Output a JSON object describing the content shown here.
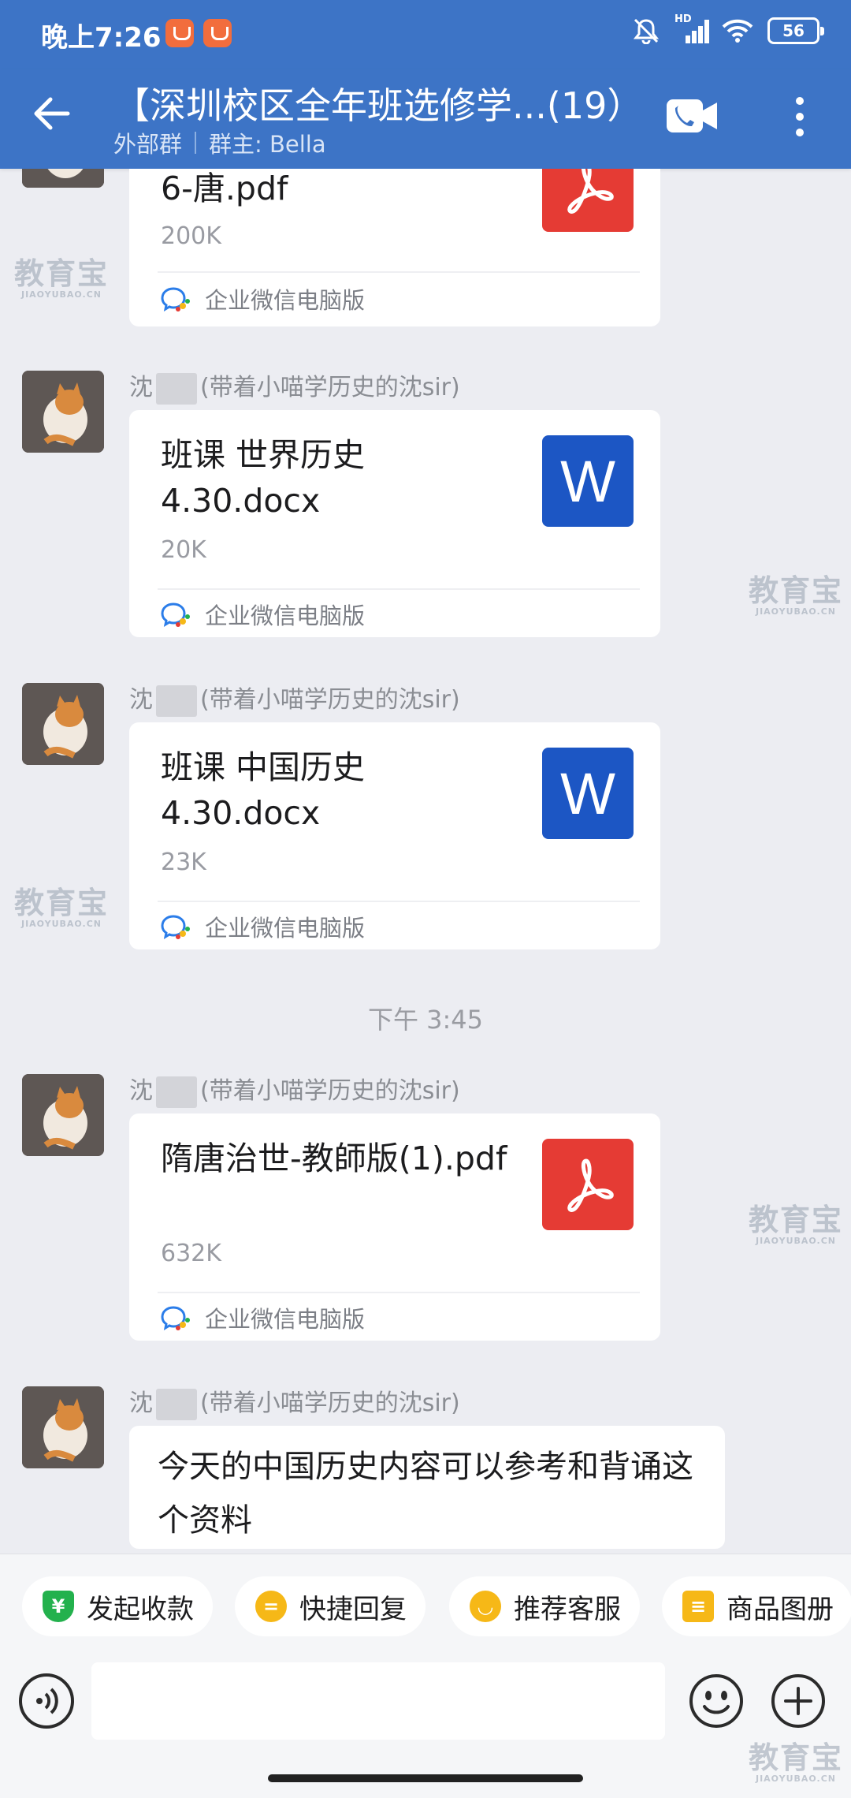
{
  "status_bar": {
    "time": "晚上7:26",
    "signal_label": "HD",
    "battery": "56"
  },
  "header": {
    "title": "【深圳校区全年班选修学...(19）",
    "group_type": "外部群",
    "owner": "群主: Bella"
  },
  "messages": {
    "m0": {
      "file_name": "6-唐.pdf",
      "file_size": "200K",
      "source": "企业微信电脑版"
    },
    "m1": {
      "sender_prefix": "沈",
      "sender_suffix": "(带着小喵学历史的沈sir)",
      "file_name": "班课 世界历史 4.30.docx",
      "file_size": "20K",
      "source": "企业微信电脑版"
    },
    "m2": {
      "sender_prefix": "沈",
      "sender_suffix": "(带着小喵学历史的沈sir)",
      "file_name": "班课 中国历史 4.30.docx",
      "file_size": "23K",
      "source": "企业微信电脑版"
    },
    "timestamp": "下午 3:45",
    "m3": {
      "sender_prefix": "沈",
      "sender_suffix": "(带着小喵学历史的沈sir)",
      "file_name": "隋唐治世-教師版(1).pdf",
      "file_size": "632K",
      "source": "企业微信电脑版"
    },
    "m4": {
      "sender_prefix": "沈",
      "sender_suffix": "(带着小喵学历史的沈sir)",
      "text": "今天的中国历史内容可以参考和背诵这个资料"
    }
  },
  "word_icon_letter": "W",
  "watermark": {
    "main": "教育宝",
    "sub": "JIAOYUBAO.CN"
  },
  "quick_actions": [
    "发起收款",
    "快捷回复",
    "推荐客服",
    "商品图册"
  ],
  "colors": {
    "header": "#3d74c6",
    "pdf": "#e53b34",
    "word": "#1c56c4",
    "background": "#ecedf2"
  }
}
